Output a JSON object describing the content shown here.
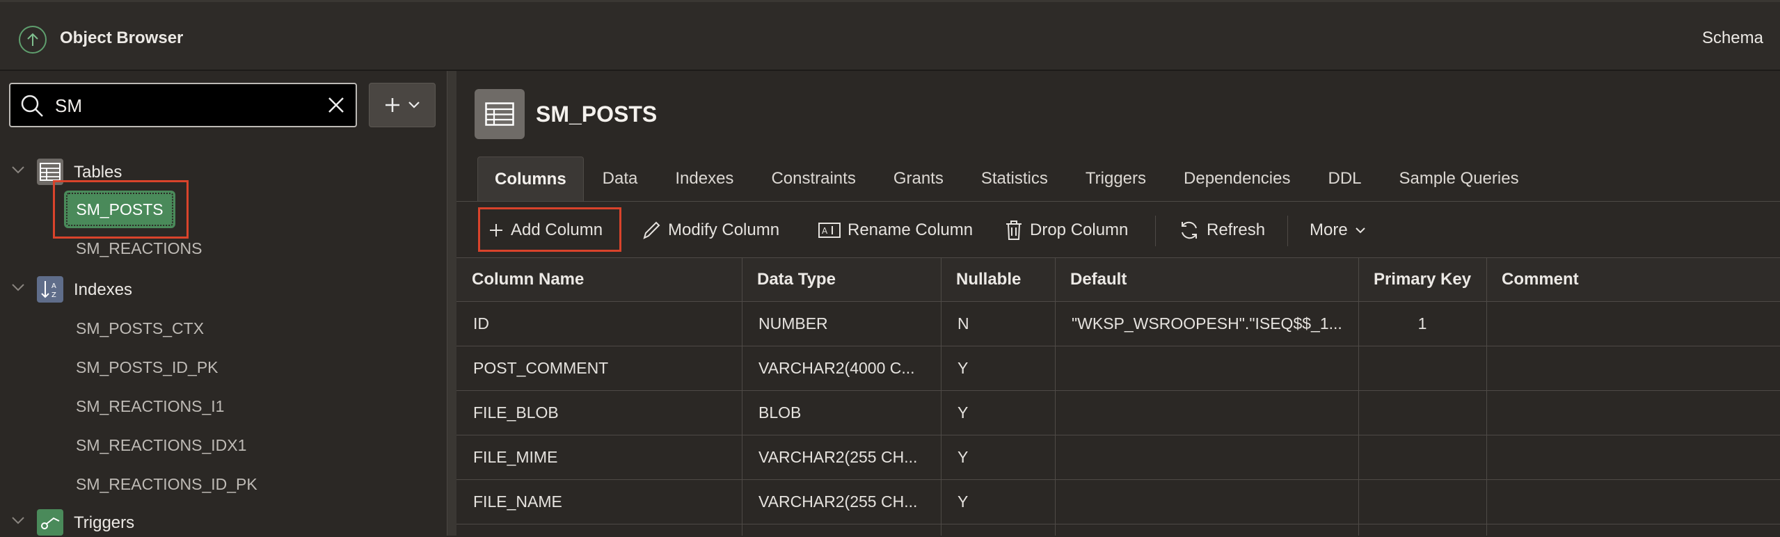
{
  "header": {
    "title": "Object Browser",
    "right_label": "Schema"
  },
  "sidebar": {
    "search": {
      "value": "SM",
      "placeholder": ""
    },
    "groups": {
      "tables": {
        "label": "Tables",
        "items": [
          "SM_POSTS",
          "SM_REACTIONS"
        ]
      },
      "indexes": {
        "label": "Indexes",
        "items": [
          "SM_POSTS_CTX",
          "SM_POSTS_ID_PK",
          "SM_REACTIONS_I1",
          "SM_REACTIONS_IDX1",
          "SM_REACTIONS_ID_PK"
        ]
      },
      "triggers": {
        "label": "Triggers"
      }
    },
    "selected": "SM_POSTS"
  },
  "object": {
    "name": "SM_POSTS",
    "tabs": [
      "Columns",
      "Data",
      "Indexes",
      "Constraints",
      "Grants",
      "Statistics",
      "Triggers",
      "Dependencies",
      "DDL",
      "Sample Queries"
    ],
    "active_tab": "Columns"
  },
  "toolbar": {
    "add_column": "Add Column",
    "modify_column": "Modify Column",
    "rename_column": "Rename Column",
    "drop_column": "Drop Column",
    "refresh": "Refresh",
    "more": "More"
  },
  "grid": {
    "headers": {
      "column_name": "Column Name",
      "data_type": "Data Type",
      "nullable": "Nullable",
      "default": "Default",
      "primary_key": "Primary Key",
      "comment": "Comment"
    },
    "rows": [
      {
        "column_name": "ID",
        "data_type": "NUMBER",
        "nullable": "N",
        "default": "\"WKSP_WSROOPESH\".\"ISEQ$$_1...",
        "primary_key": "1",
        "comment": ""
      },
      {
        "column_name": "POST_COMMENT",
        "data_type": "VARCHAR2(4000 C...",
        "nullable": "Y",
        "default": "",
        "primary_key": "",
        "comment": ""
      },
      {
        "column_name": "FILE_BLOB",
        "data_type": "BLOB",
        "nullable": "Y",
        "default": "",
        "primary_key": "",
        "comment": ""
      },
      {
        "column_name": "FILE_MIME",
        "data_type": "VARCHAR2(255 CH...",
        "nullable": "Y",
        "default": "",
        "primary_key": "",
        "comment": ""
      },
      {
        "column_name": "FILE_NAME",
        "data_type": "VARCHAR2(255 CH...",
        "nullable": "Y",
        "default": "",
        "primary_key": "",
        "comment": ""
      }
    ]
  },
  "colors": {
    "accent_green": "#4a8a5a",
    "highlight_red": "#d9432b",
    "background": "#2b2825"
  }
}
